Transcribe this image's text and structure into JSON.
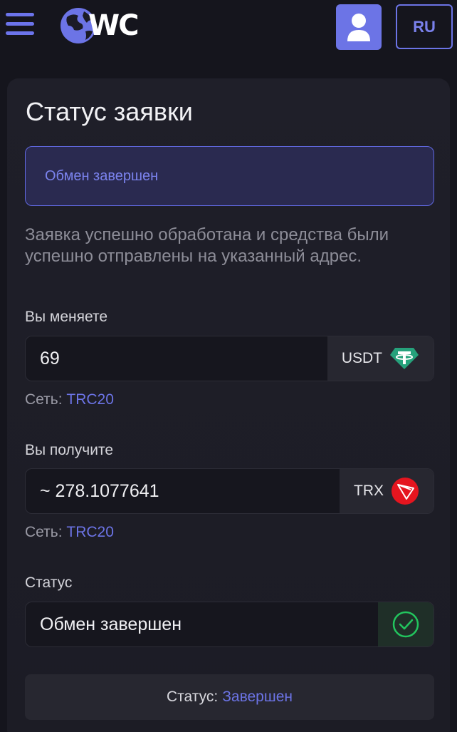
{
  "header": {
    "logo_text": "WC",
    "lang_label": "RU",
    "accent_color": "#6c74e6",
    "icons": [
      "menu-icon",
      "globe-icon",
      "user-icon"
    ]
  },
  "page": {
    "title": "Статус заявки",
    "status_banner": "Обмен завершен",
    "description": "Заявка успешно обработана и средства были успешно отправлены на указанный адрес."
  },
  "send": {
    "label": "Вы меняете",
    "amount": "69",
    "currency": "USDT",
    "network_label": "Сеть:",
    "network_value": "TRC20",
    "icon": "tether-icon"
  },
  "receive": {
    "label": "Вы получите",
    "amount": "~ 278.1077641",
    "currency": "TRX",
    "network_label": "Сеть:",
    "network_value": "TRC20",
    "icon": "tron-icon"
  },
  "status": {
    "label": "Статус",
    "value": "Обмен завершен",
    "icon": "check-circle-icon"
  },
  "footer_status": {
    "label": "Статус:",
    "value": "Завершен"
  }
}
